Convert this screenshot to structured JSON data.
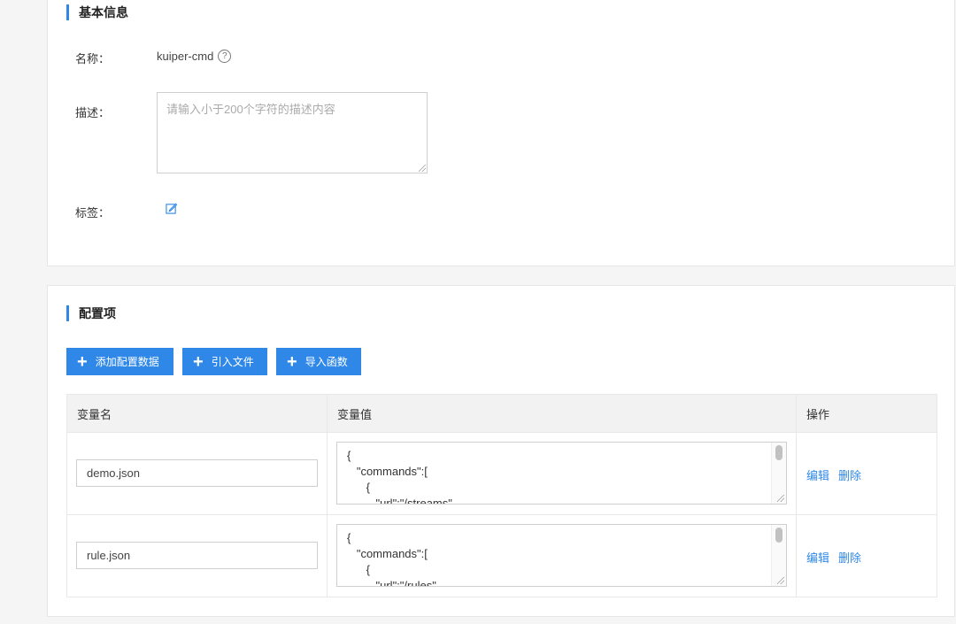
{
  "basic": {
    "title": "基本信息",
    "name_label": "名称：",
    "name_value": "kuiper-cmd",
    "help_icon": "question-circle-icon",
    "desc_label": "描述：",
    "desc_placeholder": "请输入小于200个字符的描述内容",
    "tags_label": "标签：",
    "edit_icon": "edit-icon"
  },
  "config": {
    "title": "配置项",
    "buttons": {
      "add": "添加配置数据",
      "import_file": "引入文件",
      "import_func": "导入函数"
    },
    "columns": [
      "变量名",
      "变量值",
      "操作"
    ],
    "rows": [
      {
        "name": "demo.json",
        "value_lines": [
          "{",
          "   \"commands\":[",
          "      {",
          "         \"url\":\"/streams\","
        ],
        "edit": "编辑",
        "delete": "删除"
      },
      {
        "name": "rule.json",
        "value_lines": [
          "{",
          "   \"commands\":[",
          "      {",
          "         \"url\":\"/rules\","
        ],
        "edit": "编辑",
        "delete": "删除"
      }
    ]
  },
  "colors": {
    "accent": "#2f88e8"
  }
}
